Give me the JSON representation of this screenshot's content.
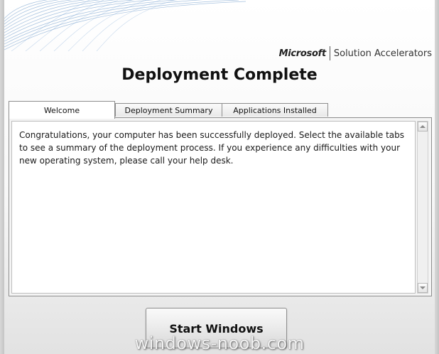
{
  "header": {
    "brand": {
      "company": "Microsoft",
      "product": "Solution Accelerators"
    },
    "title": "Deployment Complete"
  },
  "tabs": [
    {
      "label": "Welcome",
      "active": true
    },
    {
      "label": "Deployment Summary",
      "active": false
    },
    {
      "label": "Applications Installed",
      "active": false
    }
  ],
  "content": {
    "text": "Congratulations, your computer has been successfully deployed. Select the available tabs to see a summary of the deployment process.  If you experience any difficulties with your new operating system, please call your help desk."
  },
  "footer": {
    "start_button_label": "Start Windows",
    "watermark": "windows-noob.com"
  },
  "colors": {
    "background_light": "#ffffff",
    "background_dark": "#e2e2e2",
    "swirl": "#5b8ec4",
    "border": "#8d8d8d"
  },
  "icons": {
    "scroll_up": "chevron-up-icon",
    "scroll_down": "chevron-down-icon"
  }
}
